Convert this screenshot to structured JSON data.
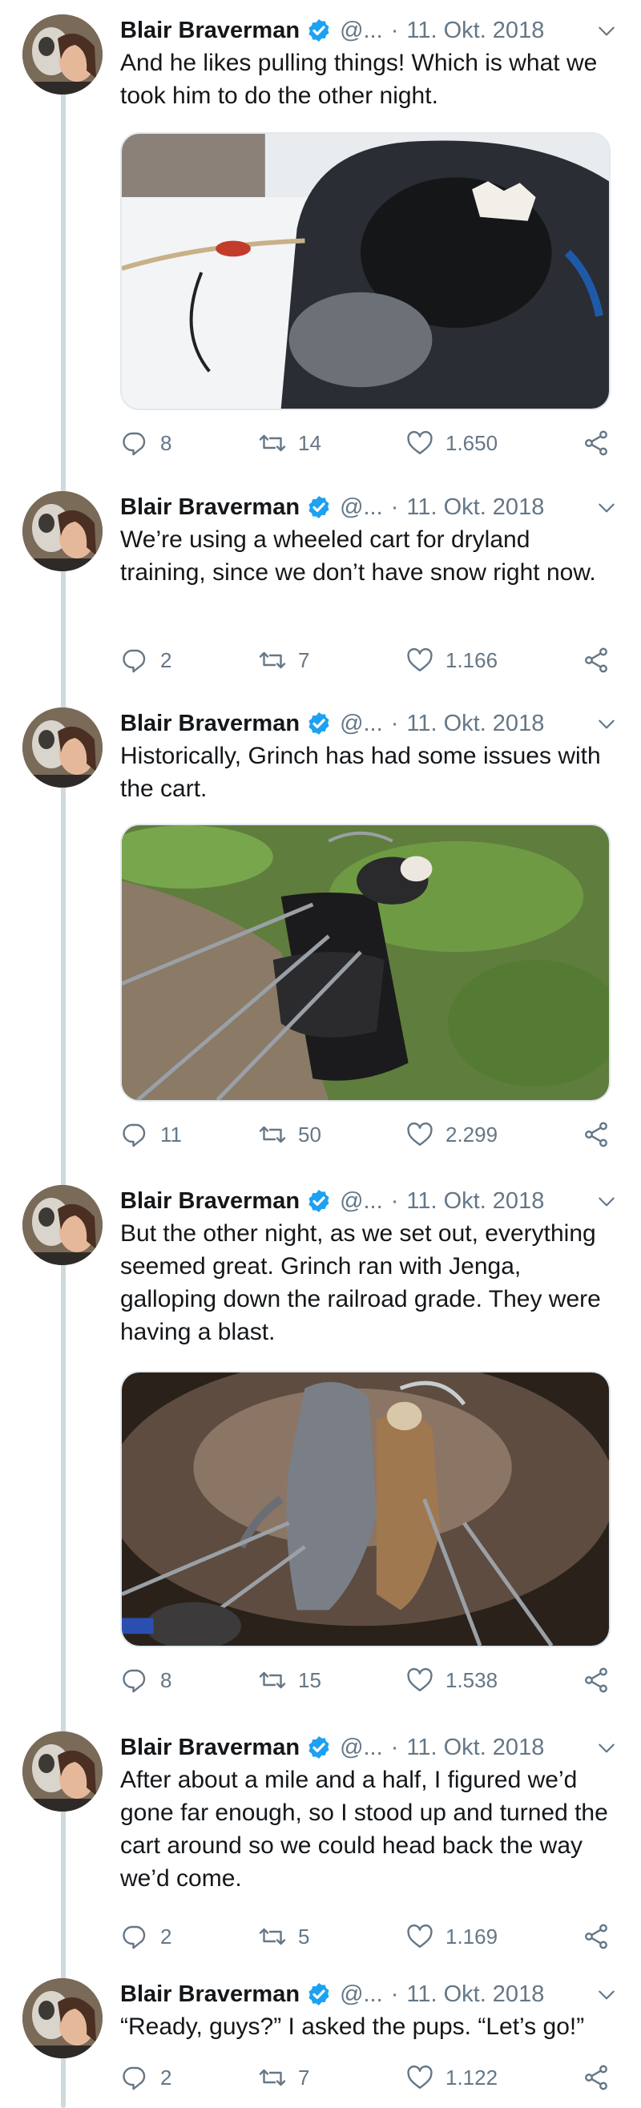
{
  "author": {
    "name": "Blair Braverman",
    "handle": "@...",
    "date": "11. Okt. 2018"
  },
  "colors": {
    "verified": "#1da1f2",
    "muted": "#657786",
    "text": "#14171a",
    "thread_line": "#cfd9de"
  },
  "icons": {
    "reply": "speech-bubble-icon",
    "retweet": "retweet-arrows-icon",
    "like": "heart-icon",
    "share": "share-nodes-icon",
    "more": "chevron-down-icon",
    "verified": "verified-badge-icon"
  },
  "tweets": [
    {
      "text": "And he likes pulling things! Which is what we took him to do the other night.",
      "media": "close-up photo of a dog's open mouth with a harness line in snow",
      "replies": "8",
      "retweets": "14",
      "likes": "1.650"
    },
    {
      "text": "We’re using a wheeled cart for dryland training, since we don’t have snow right now.",
      "replies": "2",
      "retweets": "7",
      "likes": "1.166"
    },
    {
      "text": "Historically, Grinch has had some issues with the cart.",
      "media": "two dogs in harness tangled with a wheeled cart on a forest path",
      "replies": "11",
      "retweets": "50",
      "likes": "2.299"
    },
    {
      "text": "But the other night, as we set out, everything seemed great. Grinch ran with Jenga, galloping down the railroad grade. They were having a blast.",
      "media": "two dogs running at night pulling a cart lit by a headlamp",
      "replies": "8",
      "retweets": "15",
      "likes": "1.538"
    },
    {
      "text": "After about a mile and a half, I figured we’d gone far enough, so I stood up and turned the cart around so we could head back the way we’d come.",
      "replies": "2",
      "retweets": "5",
      "likes": "1.169"
    },
    {
      "text": "“Ready, guys?” I asked the pups. “Let’s go!”",
      "replies": "2",
      "retweets": "7",
      "likes": "1.122"
    }
  ]
}
